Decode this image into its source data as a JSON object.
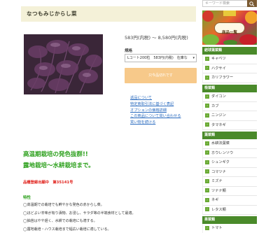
{
  "product": {
    "title": "なつもみじからし菜",
    "price": "583円(内税) ～ 8,580円(内税)",
    "spec_label": "規格",
    "spec_selected": "Lコート200粒　583円(内税)　在庫な",
    "cart_button": "只今品切れです",
    "links": [
      "返品について",
      "特定商取引法に基づく表記",
      "オプションの価格詳細",
      "この商品について問い合わせる",
      "買い物を続ける"
    ]
  },
  "description": {
    "heading1": "高温期栽培の発色抜群!!",
    "heading2": "露地栽培～水耕栽培まで。",
    "patent": "品種登録出願中　第35141号",
    "features_heading": "特性",
    "features": [
      "◯高温期での栽培でも鮮やかな発色の赤からし菜。",
      "◯ほどよい辛味が有り漬物、お浸し、サラダ等の半端食材として最適。",
      "◯抽苔はやや遅く、水耕での栽培にも適する。",
      "◯露地栽培・ハウス栽培まで幅広い栽培に適している。"
    ]
  },
  "sidebar": {
    "search_placeholder": "キーワード検索",
    "banner_label": "商品一覧",
    "categories": [
      {
        "title": "結球葉菜類",
        "items": [
          "キャベツ",
          "ハクサイ",
          "カリフラワー"
        ]
      },
      {
        "title": "根菜類",
        "items": [
          "ダイコン",
          "カブ",
          "ニンジン",
          "タマネギ"
        ]
      },
      {
        "title": "葉菜類",
        "items": [
          "水耕法葉菜",
          "ホウレンソウ",
          "シュンギク",
          "コマツナ",
          "ミズナ",
          "ツナナ類",
          "ネギ",
          "レタス類"
        ]
      },
      {
        "title": "果菜類",
        "items": [
          "トマト"
        ]
      }
    ]
  },
  "colors": {
    "accent_green": "#2ca01c",
    "category_header": "#4a8a2a",
    "cart_button": "#f7c98a",
    "link_blue": "#2a6bbf",
    "patent_red": "#e0201a"
  }
}
